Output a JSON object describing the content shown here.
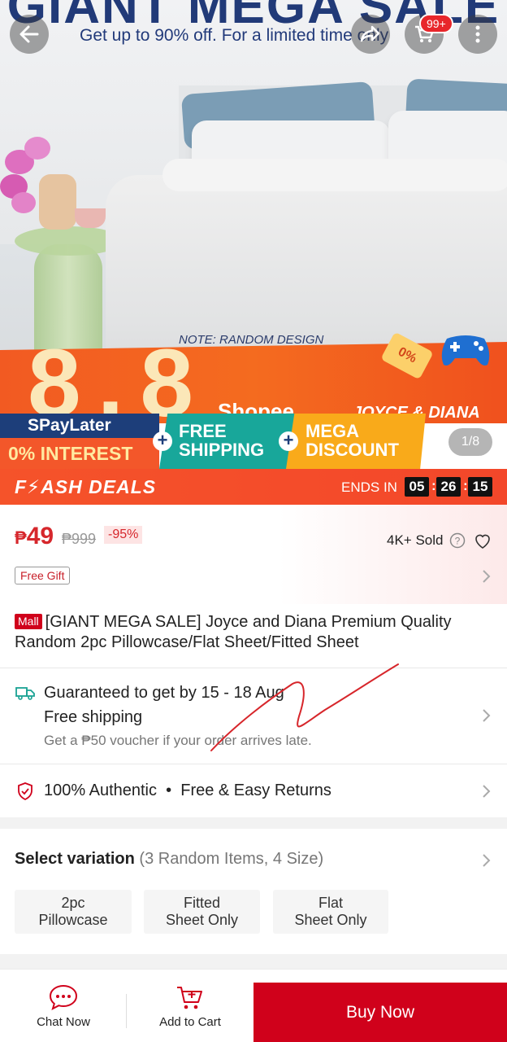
{
  "hero": {
    "headline": "GIANT MEGA SALE",
    "subheadline": "Get up to 90% off. For a limited time only",
    "note": "NOTE: RANDOM DESIGN",
    "big_number": "8.8",
    "shopee": "Shopee",
    "brand": "JOYCE & DIANA",
    "tag": "0%",
    "cart_badge": "99+",
    "pager": "1/8"
  },
  "banner": {
    "spaylater": "SPayLater",
    "interest": "0% INTEREST",
    "free_shipping_1": "FREE",
    "free_shipping_2": "SHIPPING",
    "mega_1": "MEGA",
    "mega_2": "DISCOUNT"
  },
  "flash": {
    "title": "F⚡ASH DEALS",
    "ends_label": "ENDS IN",
    "hours": "05",
    "minutes": "26",
    "seconds": "15"
  },
  "price": {
    "currency": "₱",
    "current": "49",
    "original": "₱999",
    "discount": "-95%",
    "sold": "4K+ Sold",
    "gift": "Free Gift"
  },
  "product": {
    "mall_badge": "Mall",
    "title": "[GIANT MEGA SALE] Joyce and Diana Premium Quality Random 2pc Pillowcase/Flat Sheet/Fitted Sheet"
  },
  "shipping": {
    "guarantee": "Guaranteed to get by 15 - 18 Aug",
    "free": "Free shipping",
    "voucher": "Get a ₱50 voucher if your order arrives late."
  },
  "assurance": {
    "text": "100% Authentic  •  Free & Easy Returns"
  },
  "variation": {
    "title": "Select variation",
    "subtitle": "(3 Random Items, 4 Size)",
    "options": [
      "2pc\nPillowcase",
      "Fitted\nSheet Only",
      "Flat\nSheet Only"
    ]
  },
  "bottom_bar": {
    "chat": "Chat Now",
    "add_cart": "Add to Cart",
    "buy": "Buy Now"
  },
  "colors": {
    "accent": "#d0011b",
    "flash": "#f5532a",
    "teal": "#18a79a",
    "navy": "#1d3e7a",
    "amber": "#f9aa1a"
  }
}
